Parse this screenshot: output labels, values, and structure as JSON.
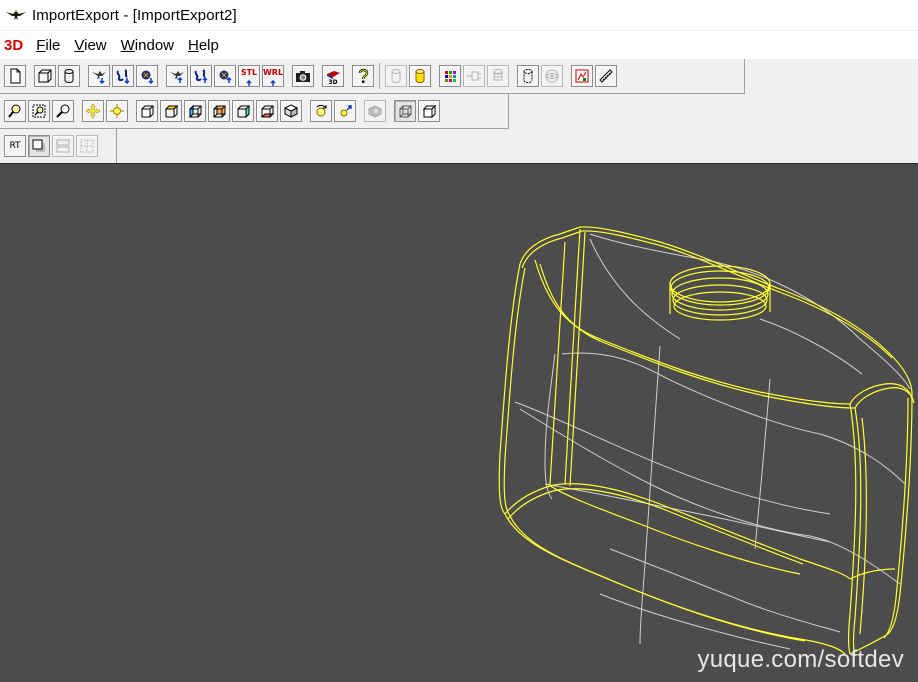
{
  "window": {
    "title": "ImportExport - [ImportExport2]"
  },
  "menubar": {
    "logo_text": "3D",
    "items": [
      {
        "key": "F",
        "rest": "ile"
      },
      {
        "key": "V",
        "rest": "iew"
      },
      {
        "key": "W",
        "rest": "indow"
      },
      {
        "key": "H",
        "rest": "elp"
      }
    ]
  },
  "toolbar1": {
    "stl_label": "STL",
    "wrl_label": "WRL",
    "d3d_label": "3D"
  },
  "toolbar3": {
    "rt_label": "RT"
  },
  "viewport": {
    "background": "#4c4c4c",
    "wire_color_outline": "#ffff33",
    "wire_color_mesh": "#d8d8d8"
  },
  "watermark": {
    "text": "yuque.com/softdev"
  },
  "colors": {
    "logo_red": "#d00000",
    "toolbar_bg": "#f0f0f0"
  }
}
